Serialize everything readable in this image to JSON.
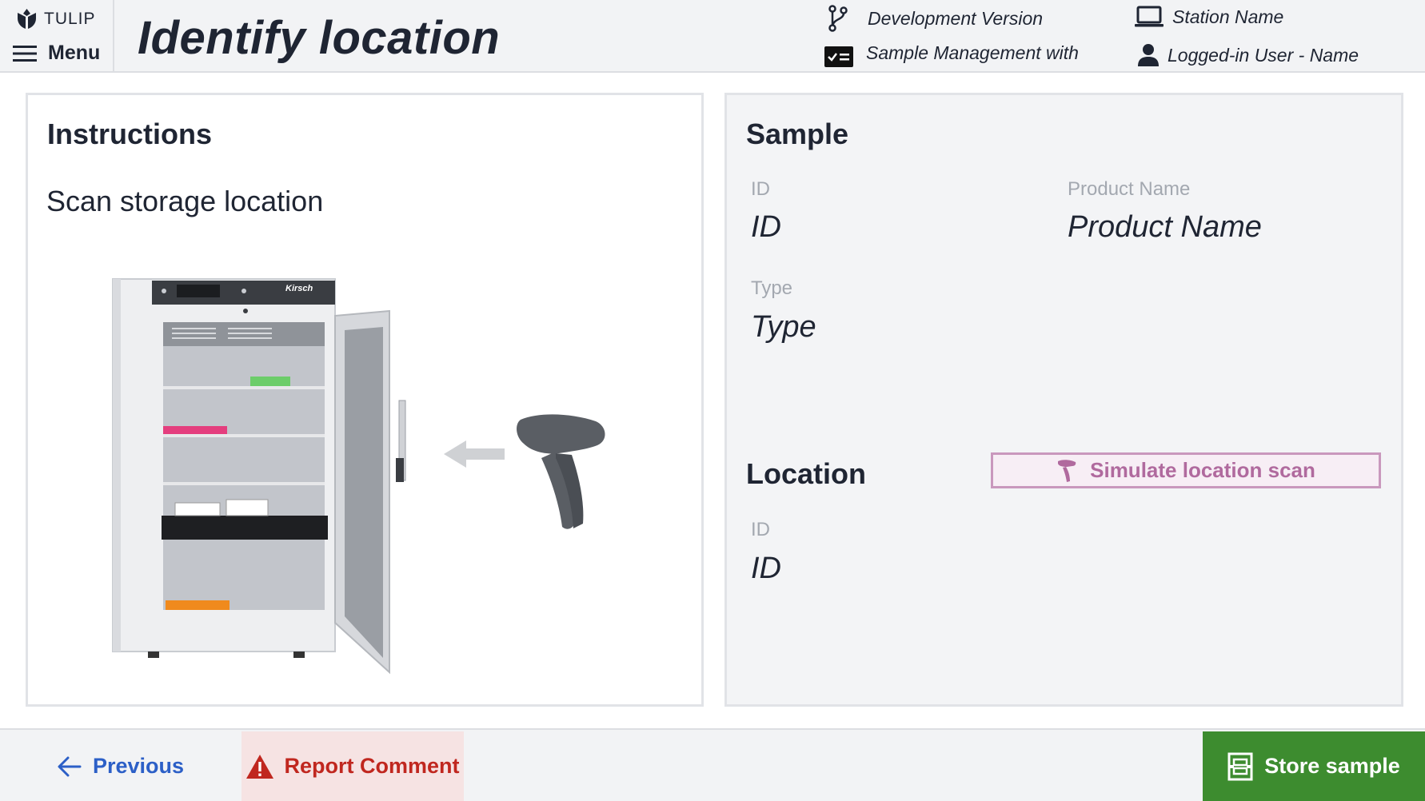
{
  "header": {
    "brand": "TULIP",
    "menu_label": "Menu",
    "title": "Identify location",
    "version": "Development Version",
    "app_name": "Sample Management with",
    "station": "Station Name",
    "user": "Logged-in User - Name"
  },
  "instructions": {
    "heading": "Instructions",
    "text": "Scan storage location",
    "fridge_brand": "Kirsch"
  },
  "sample": {
    "heading": "Sample",
    "id_label": "ID",
    "id_value": "ID",
    "product_label": "Product Name",
    "product_value": "Product Name",
    "type_label": "Type",
    "type_value": "Type"
  },
  "location": {
    "heading": "Location",
    "simulate_label": "Simulate location scan",
    "id_label": "ID",
    "id_value": "ID"
  },
  "footer": {
    "previous_label": "Previous",
    "report_label": "Report Comment",
    "store_label": "Store sample"
  },
  "colors": {
    "header_bg": "#f2f3f5",
    "text_dark": "#1f2533",
    "label_gray": "#a3a8b0",
    "link_blue": "#2c5fc7",
    "danger_red": "#c0271f",
    "danger_bg": "#f6e3e3",
    "success_green": "#3d8c2f",
    "simulate_purple": "#b06a9e"
  },
  "icons": {
    "brand": "tulip-logo-icon",
    "menu": "hamburger-icon",
    "version": "branch-icon",
    "app": "checklist-icon",
    "station": "laptop-icon",
    "user": "user-icon",
    "simulate": "barcode-scanner-icon",
    "previous": "arrow-left-icon",
    "report": "warning-icon",
    "store": "storage-icon"
  }
}
